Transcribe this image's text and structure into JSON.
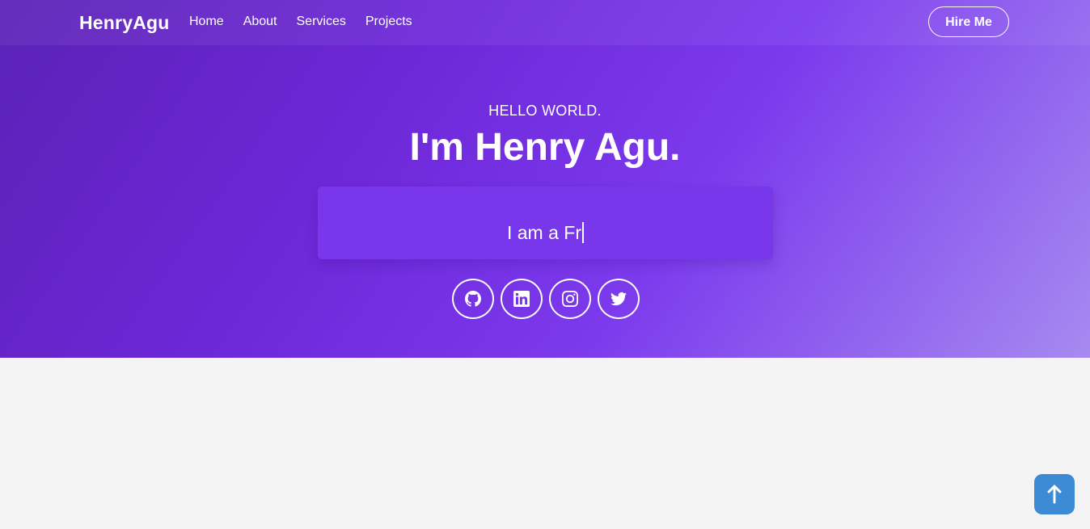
{
  "navbar": {
    "brand": "HenryAgu",
    "links": [
      "Home",
      "About",
      "Services",
      "Projects"
    ],
    "cta_label": "Hire Me"
  },
  "hero": {
    "greeting": "HELLO WORLD.",
    "headline": "I'm Henry Agu.",
    "typed_text": "I am a Fr"
  },
  "socials": [
    {
      "icon": "github-icon"
    },
    {
      "icon": "linkedin-icon"
    },
    {
      "icon": "instagram-icon"
    },
    {
      "icon": "twitter-icon"
    }
  ],
  "colors": {
    "hero_gradient_start": "#5b21b6",
    "hero_gradient_mid": "#7c3aed",
    "hero_gradient_end": "#a68af0",
    "typer_box": "#7837ea",
    "page_background": "#f4f4f4",
    "scroll_button": "#3d8bd4"
  },
  "scroll_top": {
    "icon": "arrow-up-icon"
  }
}
